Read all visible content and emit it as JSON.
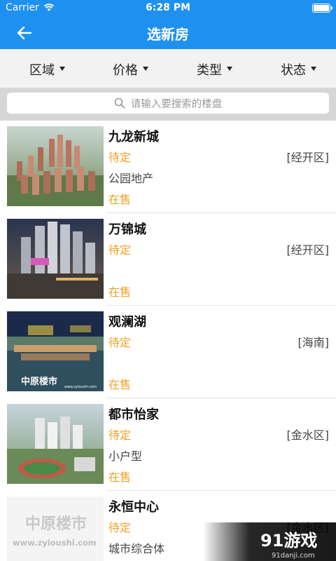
{
  "status_bar": {
    "carrier": "Carrier",
    "time": "6:28 PM"
  },
  "nav": {
    "title": "选新房",
    "back_icon": "arrow-left-icon"
  },
  "filters": [
    {
      "label": "区域"
    },
    {
      "label": "价格"
    },
    {
      "label": "类型"
    },
    {
      "label": "状态"
    }
  ],
  "search": {
    "placeholder": "请输入要搜索的楼盘"
  },
  "listings": [
    {
      "name": "九龙新城",
      "status": "待定",
      "district": "[经开区]",
      "tag": "公园地产",
      "sale": "在售"
    },
    {
      "name": "万锦城",
      "status": "待定",
      "district": "[经开区]",
      "tag": "",
      "sale": "在售"
    },
    {
      "name": "观澜湖",
      "status": "待定",
      "district": "[海南]",
      "tag": "",
      "sale": "在售",
      "thumb_text": {
        "brand": "中原楼市",
        "url": "www.zyloushi.com"
      }
    },
    {
      "name": "都市怡家",
      "status": "待定",
      "district": "[金水区]",
      "tag": "小户型",
      "sale": "在售"
    },
    {
      "name": "永恒中心",
      "status": "待定",
      "district": "[金水区]",
      "tag": "城市综合体",
      "sale": "",
      "thumb_text": {
        "brand": "中原楼市",
        "url": "www.zyloushi.com"
      }
    }
  ],
  "watermark": {
    "brand": "91游戏",
    "url": "91danji.com"
  },
  "colors": {
    "header": "#1e90f0",
    "accent": "#f0a020"
  }
}
